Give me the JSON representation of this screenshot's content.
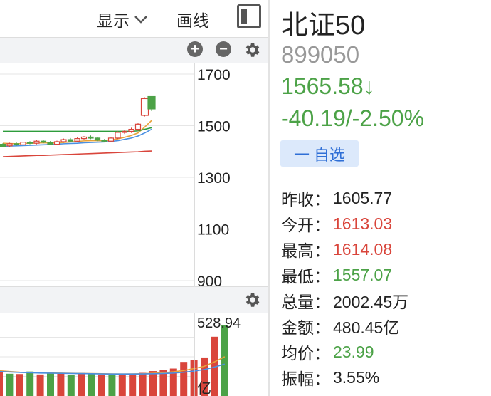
{
  "toolbar": {
    "show_label": "显示",
    "draw_label": "画线"
  },
  "price_axis": [
    "1700",
    "1500",
    "1300",
    "1100",
    "900"
  ],
  "volume_axis": {
    "max": "528.94",
    "unit": "亿"
  },
  "stock": {
    "name": "北证50",
    "code": "899050",
    "price": "1565.58↓",
    "change": "-40.19/-2.50%"
  },
  "watch_button": {
    "label": "自选"
  },
  "stats": [
    {
      "label": "昨收：",
      "value": "1605.77",
      "color": "#222222"
    },
    {
      "label": "今开：",
      "value": "1613.03",
      "color": "#d9453b"
    },
    {
      "label": "最高：",
      "value": "1614.08",
      "color": "#d9453b"
    },
    {
      "label": "最低：",
      "value": "1557.07",
      "color": "#4ca247"
    },
    {
      "label": "总量：",
      "value": "2002.45万",
      "color": "#222222"
    },
    {
      "label": "金额：",
      "value": "480.45亿",
      "color": "#222222"
    },
    {
      "label": "均价：",
      "value": "23.99",
      "color": "#4ca247"
    },
    {
      "label": "振幅：",
      "value": "3.55%",
      "color": "#222222"
    }
  ],
  "colors": {
    "up": "#d9453b",
    "down": "#4ca247",
    "accent": "#2f6fd6"
  },
  "chart_data": [
    {
      "type": "candlestick",
      "title": "",
      "ylim": [
        900,
        1700
      ],
      "yticks": [
        1700,
        1500,
        1300,
        1100,
        900
      ],
      "candles": [
        {
          "o": 1428,
          "c": 1420,
          "h": 1432,
          "l": 1416
        },
        {
          "o": 1422,
          "c": 1430,
          "h": 1434,
          "l": 1418
        },
        {
          "o": 1430,
          "c": 1426,
          "h": 1436,
          "l": 1422
        },
        {
          "o": 1426,
          "c": 1436,
          "h": 1440,
          "l": 1422
        },
        {
          "o": 1436,
          "c": 1432,
          "h": 1440,
          "l": 1428
        },
        {
          "o": 1432,
          "c": 1440,
          "h": 1444,
          "l": 1428
        },
        {
          "o": 1440,
          "c": 1436,
          "h": 1446,
          "l": 1432
        },
        {
          "o": 1436,
          "c": 1428,
          "h": 1440,
          "l": 1424
        },
        {
          "o": 1428,
          "c": 1438,
          "h": 1442,
          "l": 1424
        },
        {
          "o": 1438,
          "c": 1446,
          "h": 1450,
          "l": 1434
        },
        {
          "o": 1446,
          "c": 1440,
          "h": 1452,
          "l": 1436
        },
        {
          "o": 1440,
          "c": 1450,
          "h": 1454,
          "l": 1436
        },
        {
          "o": 1450,
          "c": 1456,
          "h": 1460,
          "l": 1446
        },
        {
          "o": 1456,
          "c": 1452,
          "h": 1462,
          "l": 1448
        },
        {
          "o": 1452,
          "c": 1444,
          "h": 1456,
          "l": 1440
        },
        {
          "o": 1444,
          "c": 1440,
          "h": 1448,
          "l": 1436
        },
        {
          "o": 1440,
          "c": 1452,
          "h": 1456,
          "l": 1436
        },
        {
          "o": 1452,
          "c": 1474,
          "h": 1478,
          "l": 1448
        },
        {
          "o": 1474,
          "c": 1478,
          "h": 1484,
          "l": 1468
        },
        {
          "o": 1478,
          "c": 1486,
          "h": 1492,
          "l": 1472
        },
        {
          "o": 1486,
          "c": 1506,
          "h": 1512,
          "l": 1480
        },
        {
          "o": 1540,
          "c": 1605,
          "h": 1610,
          "l": 1536
        },
        {
          "o": 1613,
          "c": 1565,
          "h": 1614,
          "l": 1557
        }
      ],
      "ma": [
        {
          "name": "",
          "color": "#e8a23a",
          "values": [
            1432,
            1431,
            1430,
            1431,
            1432,
            1433,
            1434,
            1433,
            1433,
            1435,
            1437,
            1439,
            1441,
            1442,
            1442,
            1442,
            1444,
            1449,
            1455,
            1462,
            1472,
            1495,
            1520
          ]
        },
        {
          "name": "",
          "color": "#4a90e2",
          "values": [
            1420,
            1421,
            1422,
            1423,
            1424,
            1425,
            1426,
            1427,
            1428,
            1430,
            1431,
            1432,
            1434,
            1435,
            1436,
            1437,
            1439,
            1442,
            1447,
            1452,
            1460,
            1472,
            1486
          ]
        },
        {
          "name": "",
          "color": "#2e9c3c",
          "values": [
            1478,
            1478,
            1478,
            1478,
            1478,
            1478,
            1478,
            1478,
            1478,
            1478,
            1478,
            1478,
            1478,
            1478,
            1478,
            1478,
            1478,
            1478,
            1478,
            1478,
            1480,
            1486,
            1492
          ]
        },
        {
          "name": "",
          "color": "#d9453b",
          "values": [
            1380,
            1381,
            1382,
            1383,
            1384,
            1385,
            1385,
            1386,
            1387,
            1388,
            1389,
            1390,
            1391,
            1392,
            1393,
            1394,
            1395,
            1396,
            1397,
            1398,
            1399,
            1401,
            1402
          ]
        }
      ]
    },
    {
      "type": "bar",
      "title": "",
      "ylim": [
        0,
        528.94
      ],
      "unit": "亿",
      "values": [
        160,
        150,
        148,
        165,
        145,
        160,
        150,
        142,
        155,
        150,
        145,
        140,
        148,
        150,
        156,
        168,
        175,
        185,
        230,
        245,
        260,
        400,
        480
      ],
      "colors": [
        "red",
        "green",
        "red",
        "green",
        "red",
        "green",
        "red",
        "green",
        "red",
        "green",
        "red",
        "green",
        "red",
        "red",
        "red",
        "red",
        "red",
        "red",
        "red",
        "red",
        "red",
        "red",
        "green"
      ],
      "ma": [
        {
          "name": "",
          "color": "#e8a23a",
          "values": [
            170,
            165,
            160,
            158,
            156,
            155,
            154,
            153,
            152,
            151,
            150,
            149,
            148,
            149,
            150,
            153,
            157,
            163,
            172,
            185,
            200,
            230,
            265
          ]
        },
        {
          "name": "",
          "color": "#4a90e2",
          "values": [
            165,
            162,
            159,
            157,
            155,
            154,
            153,
            152,
            151,
            150,
            149,
            148,
            148,
            148,
            149,
            150,
            152,
            155,
            160,
            168,
            178,
            195,
            215
          ]
        }
      ]
    }
  ]
}
